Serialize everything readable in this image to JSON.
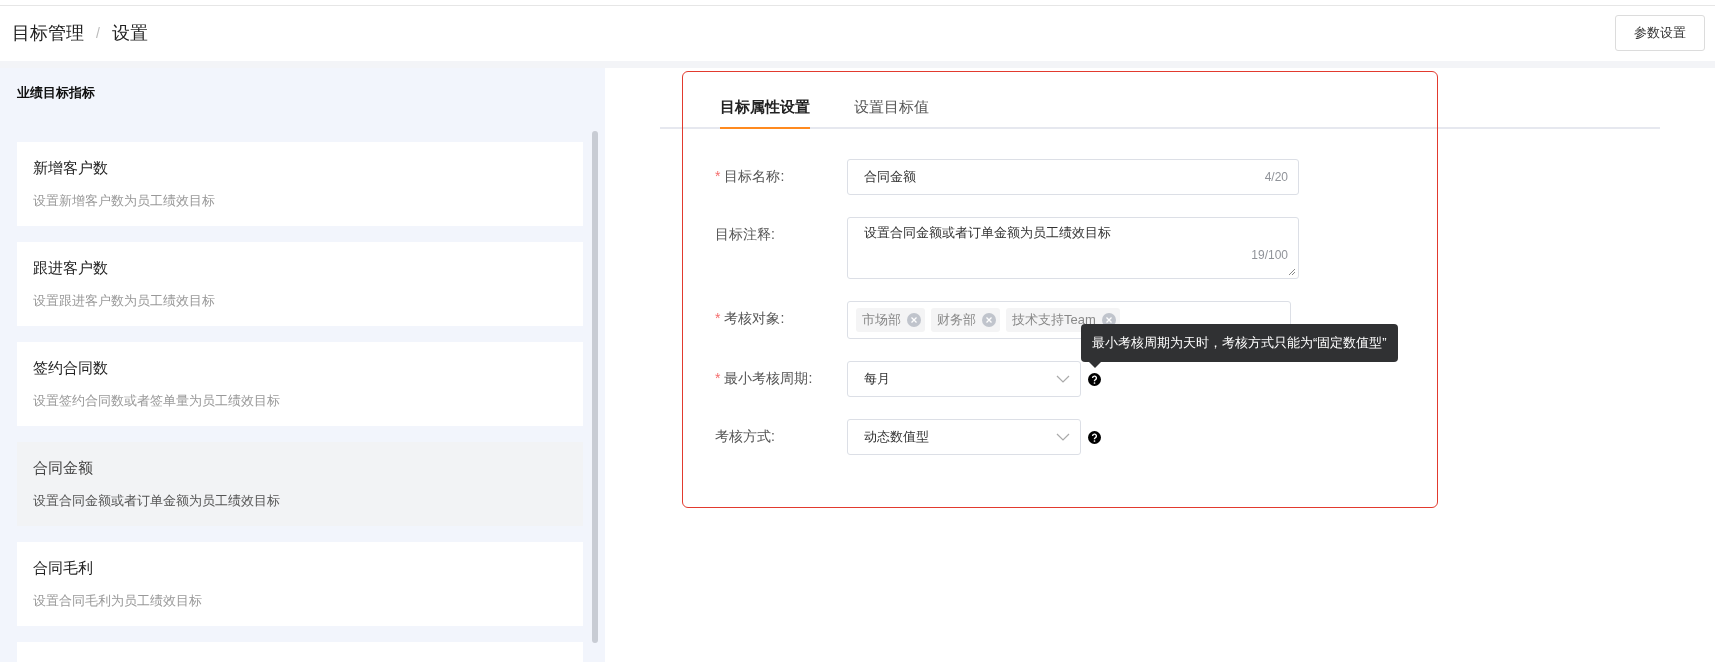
{
  "header": {
    "breadcrumb": [
      "目标管理",
      "设置"
    ],
    "separator": "/",
    "button": "参数设置"
  },
  "sidebar": {
    "title": "业绩目标指标",
    "items": [
      {
        "title": "新增客户数",
        "description": "设置新增客户数为员工绩效目标",
        "selected": false
      },
      {
        "title": "跟进客户数",
        "description": "设置跟进客户数为员工绩效目标",
        "selected": false
      },
      {
        "title": "签约合同数",
        "description": "设置签约合同数或者签单量为员工绩效目标",
        "selected": false
      },
      {
        "title": "合同金额",
        "description": "设置合同金额或者订单金额为员工绩效目标",
        "selected": true
      },
      {
        "title": "合同毛利",
        "description": "设置合同毛利为员工绩效目标",
        "selected": false
      }
    ]
  },
  "tabs": [
    {
      "label": "目标属性设置",
      "selected": true
    },
    {
      "label": "设置目标值",
      "selected": false
    }
  ],
  "form": {
    "fields": [
      {
        "kind": "text",
        "label": "目标名称:",
        "required_mark": "*",
        "value": "合同金额",
        "counter": "4/20"
      },
      {
        "kind": "textarea",
        "label": "目标注释:",
        "value": "设置合同金额或者订单金额为员工绩效目标",
        "counter": "19/100"
      },
      {
        "kind": "tags",
        "label": "考核对象:",
        "required_mark": "*",
        "tags": [
          "市场部",
          "财务部",
          "技术支持Team"
        ]
      },
      {
        "kind": "select",
        "label": "最小考核周期:",
        "required_mark": "*",
        "value": "每月",
        "help": true,
        "tooltip": "最小考核周期为天时，考核方式只能为“固定数值型”"
      },
      {
        "kind": "select",
        "label": "考核方式:",
        "value": "动态数值型",
        "help": true
      }
    ]
  }
}
